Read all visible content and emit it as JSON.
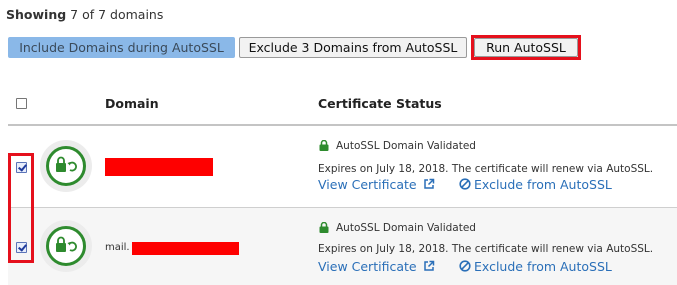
{
  "showing": {
    "prefix": "Showing",
    "text": " 7 of 7 domains"
  },
  "buttons": {
    "include": "Include Domains during AutoSSL",
    "exclude": "Exclude 3 Domains from AutoSSL",
    "run": "Run AutoSSL"
  },
  "table": {
    "headers": {
      "domain": "Domain",
      "status": "Certificate Status"
    },
    "rows": [
      {
        "domain_prefix": "",
        "status": "AutoSSL Domain Validated",
        "expires": "Expires on July 18, 2018. The certificate will renew via AutoSSL.",
        "view": "View Certificate",
        "exclude": "Exclude from AutoSSL",
        "checked": true
      },
      {
        "domain_prefix": "mail.",
        "status": "AutoSSL Domain Validated",
        "expires": "Expires on July 18, 2018. The certificate will renew via AutoSSL.",
        "view": "View Certificate",
        "exclude": "Exclude from AutoSSL",
        "checked": true
      }
    ]
  },
  "colors": {
    "accent_green": "#2e8b2e",
    "link_blue": "#2a6fb8",
    "highlight_red": "#e5101c"
  }
}
